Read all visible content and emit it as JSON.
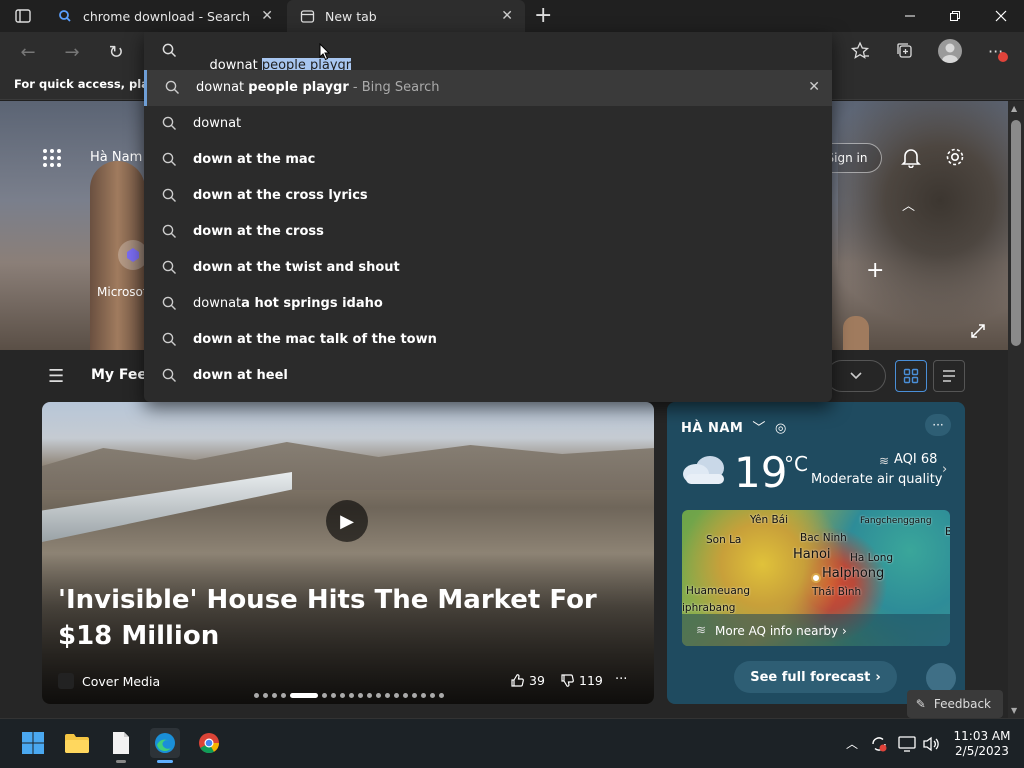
{
  "tabs": [
    {
      "title": "chrome download - Search"
    },
    {
      "title": "New tab"
    }
  ],
  "address": {
    "typed": "downat ",
    "selected": "people playgr"
  },
  "favorites_bar": {
    "text": "For quick access, place y"
  },
  "suggestions": [
    {
      "prefix": "downat ",
      "bold": "people playgr",
      "suffix": " - Bing Search"
    },
    {
      "prefix": "downat",
      "bold": "",
      "suffix": ""
    },
    {
      "prefix": "",
      "bold": "down at the mac",
      "suffix": ""
    },
    {
      "prefix": "",
      "bold": "down at the cross lyrics",
      "suffix": ""
    },
    {
      "prefix": "",
      "bold": "down at the cross",
      "suffix": ""
    },
    {
      "prefix": "",
      "bold": "down at the twist and shout",
      "suffix": ""
    },
    {
      "prefix": "downat",
      "bold": "a hot springs idaho",
      "suffix": ""
    },
    {
      "prefix": "",
      "bold": "down at the mac talk of the town",
      "suffix": ""
    },
    {
      "prefix": "",
      "bold": "down at heel",
      "suffix": ""
    }
  ],
  "hero": {
    "location": "Hà Nam",
    "app_label": "Microsof",
    "sign_in": "Sign in"
  },
  "feed": {
    "title": "My Feed",
    "card": {
      "headline": "'Invisible' House Hits The Market For $18 Million",
      "source": "Cover Media",
      "likes": "39",
      "dislikes": "119"
    }
  },
  "weather": {
    "location": "HÀ NAM",
    "temp": "19",
    "unit": "°C",
    "aqi": "AQI 68",
    "aq_text": "Moderate air quality",
    "map_labels": {
      "yen_bai": "Yên Bái",
      "son_la": "Son La",
      "bac_ninh": "Bac Ninh",
      "hanoi": "Hanoi",
      "ha_long": "Ha Long",
      "fangcheng": "Fangchenggang",
      "huameuang": "Huameuang",
      "halphong": "Halphong",
      "thai_binh": "Thái Bình",
      "phrabang": "iphrabang",
      "edge_b": "B"
    },
    "more_aq": "More AQ info nearby",
    "forecast": "See full forecast"
  },
  "feedback": "Feedback",
  "clock": {
    "time": "11:03 AM",
    "date": "2/5/2023"
  }
}
